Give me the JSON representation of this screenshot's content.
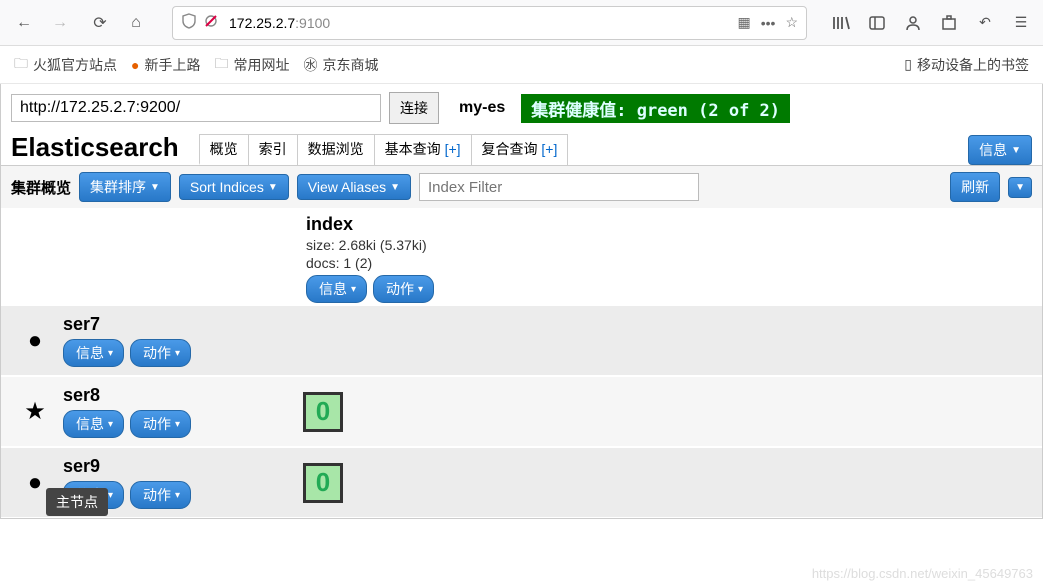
{
  "browser": {
    "url_host": "172.25.2.7",
    "url_port": ":9100"
  },
  "bookmarks": {
    "items": [
      "火狐官方站点",
      "新手上路",
      "常用网址",
      "京东商城"
    ],
    "mobile": "移动设备上的书签"
  },
  "connect": {
    "url": "http://172.25.2.7:9200/",
    "btn": "连接",
    "cluster_name": "my-es",
    "health": "集群健康值: green (2 of 2)"
  },
  "app_title": "Elasticsearch",
  "tabs": {
    "overview": "概览",
    "indices": "索引",
    "browse": "数据浏览",
    "basic_query": "基本查询",
    "compound_query": "复合查询",
    "plus": "[+]",
    "info": "信息"
  },
  "overview": {
    "label": "集群概览",
    "sort_cluster": "集群排序",
    "sort_indices": "Sort Indices",
    "view_aliases": "View Aliases",
    "filter_placeholder": "Index Filter",
    "refresh": "刷新"
  },
  "index": {
    "name": "index",
    "size_line": "size: 2.68ki (5.37ki)",
    "docs_line": "docs: 1 (2)",
    "info_btn": "信息",
    "action_btn": "动作"
  },
  "nodes": [
    {
      "name": "ser7",
      "icon": "●",
      "has_shard": false,
      "shard": ""
    },
    {
      "name": "ser8",
      "icon": "★",
      "has_shard": true,
      "shard": "0"
    },
    {
      "name": "ser9",
      "icon": "●",
      "has_shard": true,
      "shard": "0"
    }
  ],
  "node_btn": {
    "info": "信息",
    "action": "动作"
  },
  "tooltip": "主节点",
  "watermark": "https://blog.csdn.net/weixin_45649763"
}
